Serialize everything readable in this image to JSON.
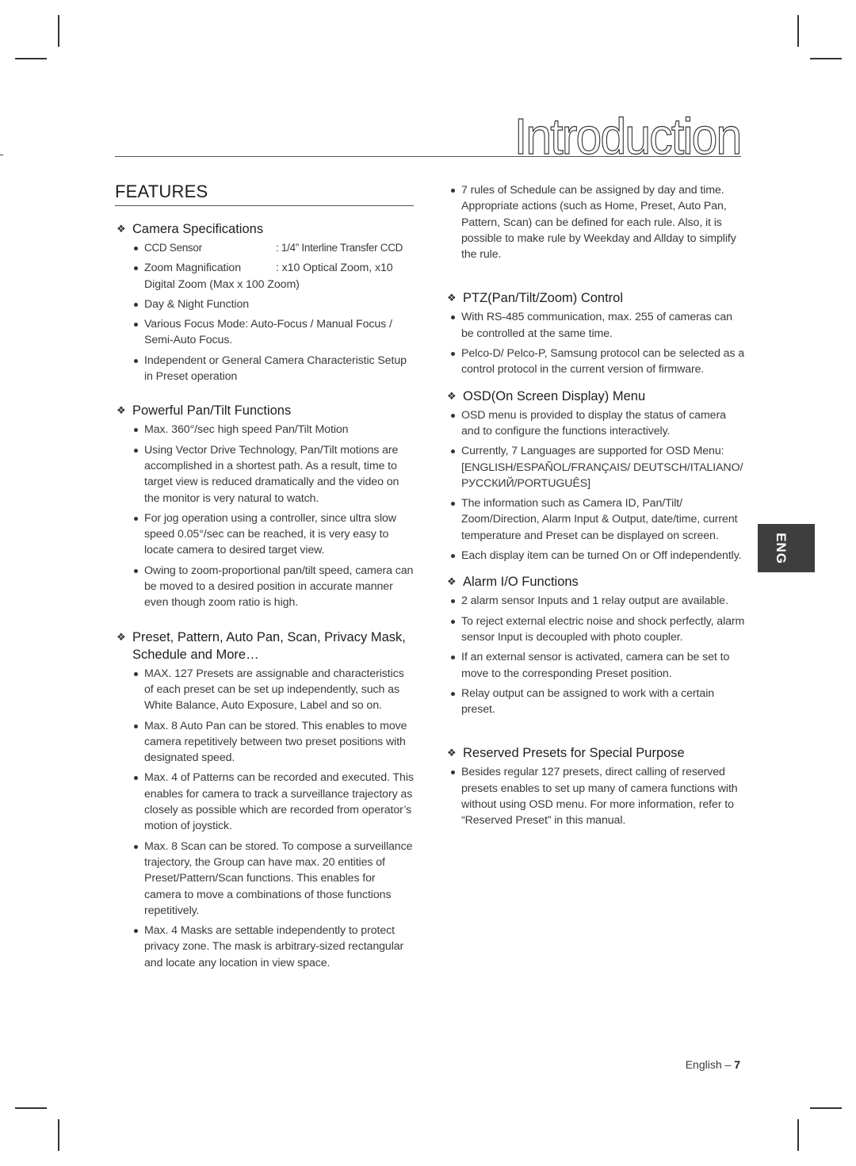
{
  "page": {
    "title": "Introduction",
    "section_heading": "FEATURES",
    "language_tab": "ENG",
    "footer": {
      "label": "English –",
      "page_number": "7"
    }
  },
  "left_column": {
    "sections": [
      {
        "heading": "Camera Specifications",
        "specs": [
          {
            "key": "CCD Sensor",
            "value": ": 1/4” Interline Transfer CCD"
          },
          {
            "key": "Zoom Magnification",
            "value": ": x10 Optical Zoom, x10 Digital Zoom (Max x 100 Zoom)"
          }
        ],
        "items": [
          "Day & Night Function",
          "Various Focus Mode: Auto-Focus / Manual Focus / Semi-Auto Focus.",
          "Independent or General Camera Characteristic Setup in Preset operation"
        ]
      },
      {
        "heading": "Powerful Pan/Tilt Functions",
        "items": [
          "Max. 360°/sec high speed Pan/Tilt Motion",
          "Using Vector Drive Technology, Pan/Tilt motions are accomplished in a shortest path. As a result, time to target view is reduced dramatically and the video on the monitor is very natural to watch.",
          "For jog operation using a controller, since ultra slow speed 0.05°/sec can be reached, it is very easy to locate camera to desired target view.",
          "Owing to zoom-proportional pan/tilt speed, camera can be moved to a desired position in accurate manner even though zoom ratio is high."
        ]
      },
      {
        "heading": "Preset, Pattern, Auto Pan, Scan, Privacy Mask, Schedule and More…",
        "items": [
          "MAX. 127 Presets are assignable and characteristics of each preset can be set up independently, such as White Balance, Auto Exposure, Label and so on.",
          "Max. 8 Auto Pan can be stored. This enables to move camera repetitively between two preset positions with designated speed.",
          "Max. 4 of Patterns can be recorded and executed. This enables for camera to track a surveillance trajectory as closely as possible which are recorded from operator’s motion of joystick.",
          "Max. 8 Scan can be stored. To compose a surveillance trajectory, the Group can have max. 20 entities of Preset/Pattern/Scan functions. This enables for camera to move a combinations of those functions repetitively.",
          "Max. 4 Masks are settable independently to protect privacy zone. The mask is arbitrary-sized rectangular and locate any location in view space."
        ]
      }
    ]
  },
  "right_column": {
    "continued_items": [
      "7 rules of Schedule can be assigned by day and time. Appropriate actions (such as Home, Preset, Auto Pan, Pattern, Scan) can be defined for each rule. Also, it is possible to make rule by Weekday and Allday to simplify the rule."
    ],
    "sections": [
      {
        "heading": "PTZ(Pan/Tilt/Zoom) Control",
        "items": [
          "With RS-485 communication, max. 255 of cameras can be controlled at the same time.",
          "Pelco-D/ Pelco-P, Samsung protocol can be selected as a control protocol in the current version of firmware."
        ]
      },
      {
        "heading": "OSD(On Screen Display) Menu",
        "items": [
          "OSD menu is provided to display the status of camera and to configure the functions interactively.",
          "Currently, 7 Languages are supported for OSD Menu: [ENGLISH/ESPAÑOL/FRANÇAIS/ DEUTSCH/ITALIANO/РУССКИЙ/PORTUGUÊS]",
          "The information such as Camera ID, Pan/Tilt/ Zoom/Direction, Alarm Input & Output, date/time, current temperature and Preset can be displayed on screen.",
          "Each display item can be turned On or Off independently."
        ]
      },
      {
        "heading": "Alarm I/O Functions",
        "items": [
          "2 alarm sensor Inputs and 1 relay output are available.",
          "To reject external electric noise and shock perfectly, alarm sensor Input is decoupled with photo coupler.",
          "If an external sensor is activated, camera can be set to move to the corresponding Preset position.",
          "Relay output can be assigned to work with a certain preset."
        ]
      },
      {
        "heading": "Reserved Presets for Special Purpose",
        "items": [
          "Besides regular 127 presets, direct calling of reserved presets enables to set up many of camera functions with without using OSD menu. For more information, refer to “Reserved Preset” in this manual."
        ]
      }
    ]
  },
  "icons": {
    "section_bullet": "❖",
    "list_bullet": "bullet-dot"
  }
}
